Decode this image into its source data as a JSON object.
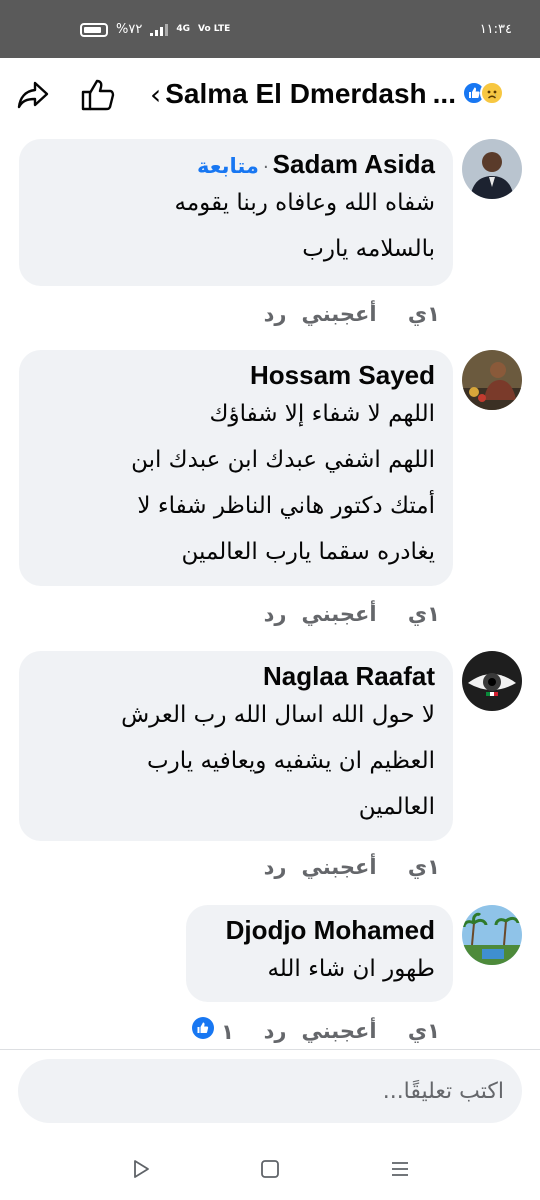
{
  "status_bar": {
    "battery_percent": "%٧٢",
    "network": "4G",
    "volte": "Vo LTE",
    "time": "١١:٣٤"
  },
  "header": {
    "title": "Salma El Dmerdash",
    "ellipsis": "...",
    "share_icon": "share-icon",
    "like_icon": "thumbs-up-icon",
    "back_icon": "chevron-left-icon",
    "reactions": [
      "like-reaction-icon",
      "sad-reaction-icon"
    ]
  },
  "comments": [
    {
      "author": "Sadam Asida",
      "follow_label": "متابعة",
      "lines": [
        "شفاه الله وعافاه ربنا يقومه",
        "بالسلامه يارب"
      ],
      "time": "١ي",
      "like_label": "أعجبني",
      "reply_label": "رد"
    },
    {
      "author": "Hossam Sayed",
      "lines": [
        "اللهم لا شفاء إلا شفاؤك",
        "اللهم اشفي عبدك ابن عبدك ابن",
        "أمتك دكتور هاني الناظر شفاء لا",
        "يغادره سقما يارب العالمين"
      ],
      "time": "١ي",
      "like_label": "أعجبني",
      "reply_label": "رد"
    },
    {
      "author": "Naglaa Raafat",
      "lines": [
        "لا حول الله اسال الله رب العرش",
        "العظيم ان يشفيه ويعافيه يارب",
        "العالمين"
      ],
      "time": "١ي",
      "like_label": "أعجبني",
      "reply_label": "رد"
    },
    {
      "author": "Djodjo Mohamed",
      "lines": [
        "طهور ان شاء الله"
      ],
      "time": "١ي",
      "like_label": "أعجبني",
      "reply_label": "رد",
      "like_count": "١"
    }
  ],
  "composer": {
    "placeholder": "اكتب تعليقًا..."
  },
  "colors": {
    "accent": "#1877f2",
    "bubble": "#f0f2f5",
    "status_bar": "#5a5a5a",
    "secondary_text": "#65676b"
  }
}
